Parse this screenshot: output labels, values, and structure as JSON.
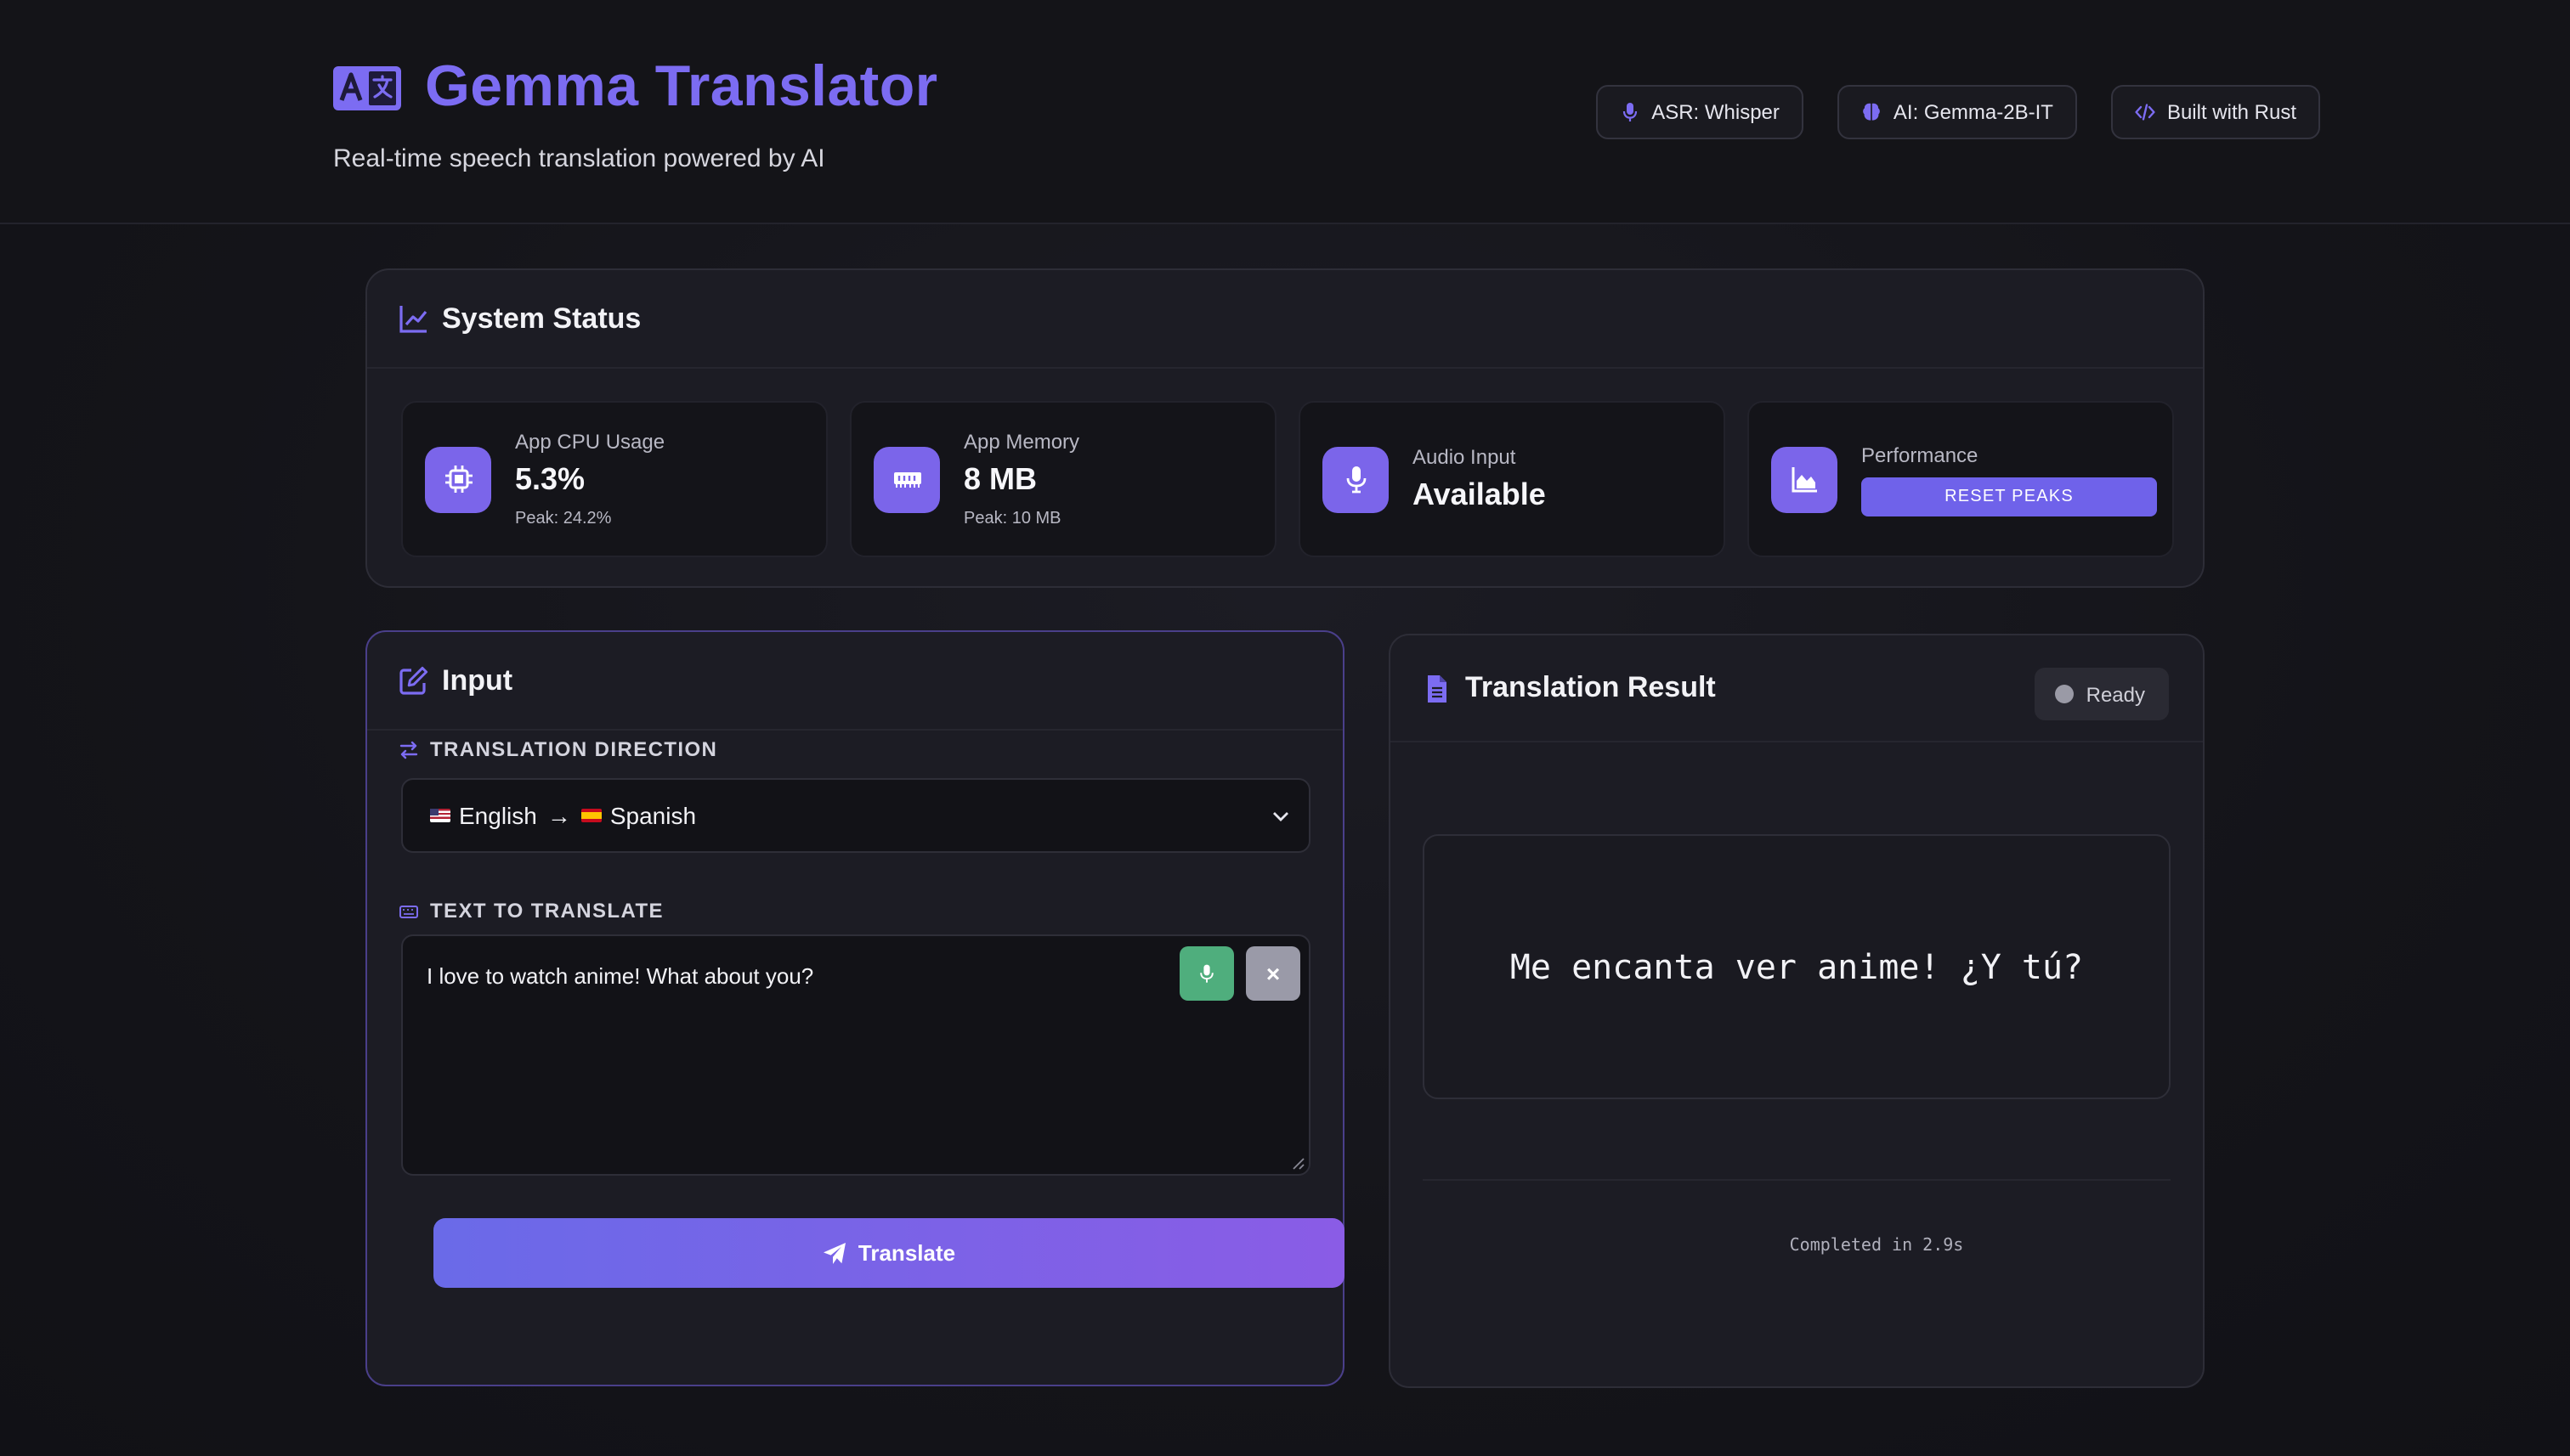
{
  "header": {
    "title": "Gemma Translator",
    "subtitle": "Real-time speech translation powered by AI",
    "logo_icon": "translate-icon",
    "badges": [
      {
        "icon": "microphone-icon",
        "label": "ASR: Whisper"
      },
      {
        "icon": "brain-icon",
        "label": "AI: Gemma-2B-IT"
      },
      {
        "icon": "code-icon",
        "label": "Built with Rust"
      }
    ]
  },
  "status": {
    "title": "System Status",
    "icon": "chart-line-icon",
    "cards": {
      "cpu": {
        "icon": "microchip-icon",
        "label": "App CPU Usage",
        "value": "5.3%",
        "peak": "Peak: 24.2%"
      },
      "memory": {
        "icon": "memory-icon",
        "label": "App Memory",
        "value": "8 MB",
        "peak": "Peak: 10 MB"
      },
      "audio": {
        "icon": "microphone-icon",
        "label": "Audio Input",
        "value": "Available"
      },
      "performance": {
        "icon": "chart-area-icon",
        "label": "Performance",
        "reset_label": "RESET PEAKS"
      }
    }
  },
  "input": {
    "title": "Input",
    "icon": "edit-icon",
    "direction_label": "TRANSLATION DIRECTION",
    "direction_from": "English",
    "direction_arrow": "→",
    "direction_to": "Spanish",
    "text_label": "TEXT TO TRANSLATE",
    "text_value": "I love to watch anime! What about you?",
    "clear_label": "×",
    "translate_label": "Translate"
  },
  "result": {
    "title": "Translation Result",
    "icon": "file-icon",
    "status": "Ready",
    "text": "Me encanta ver anime! ¿Y tú?",
    "completed": "Completed in 2.9s"
  },
  "colors": {
    "accent": "#7c6cf2",
    "mic_button": "#4fae7d",
    "clear_button": "#9a9aa8"
  }
}
